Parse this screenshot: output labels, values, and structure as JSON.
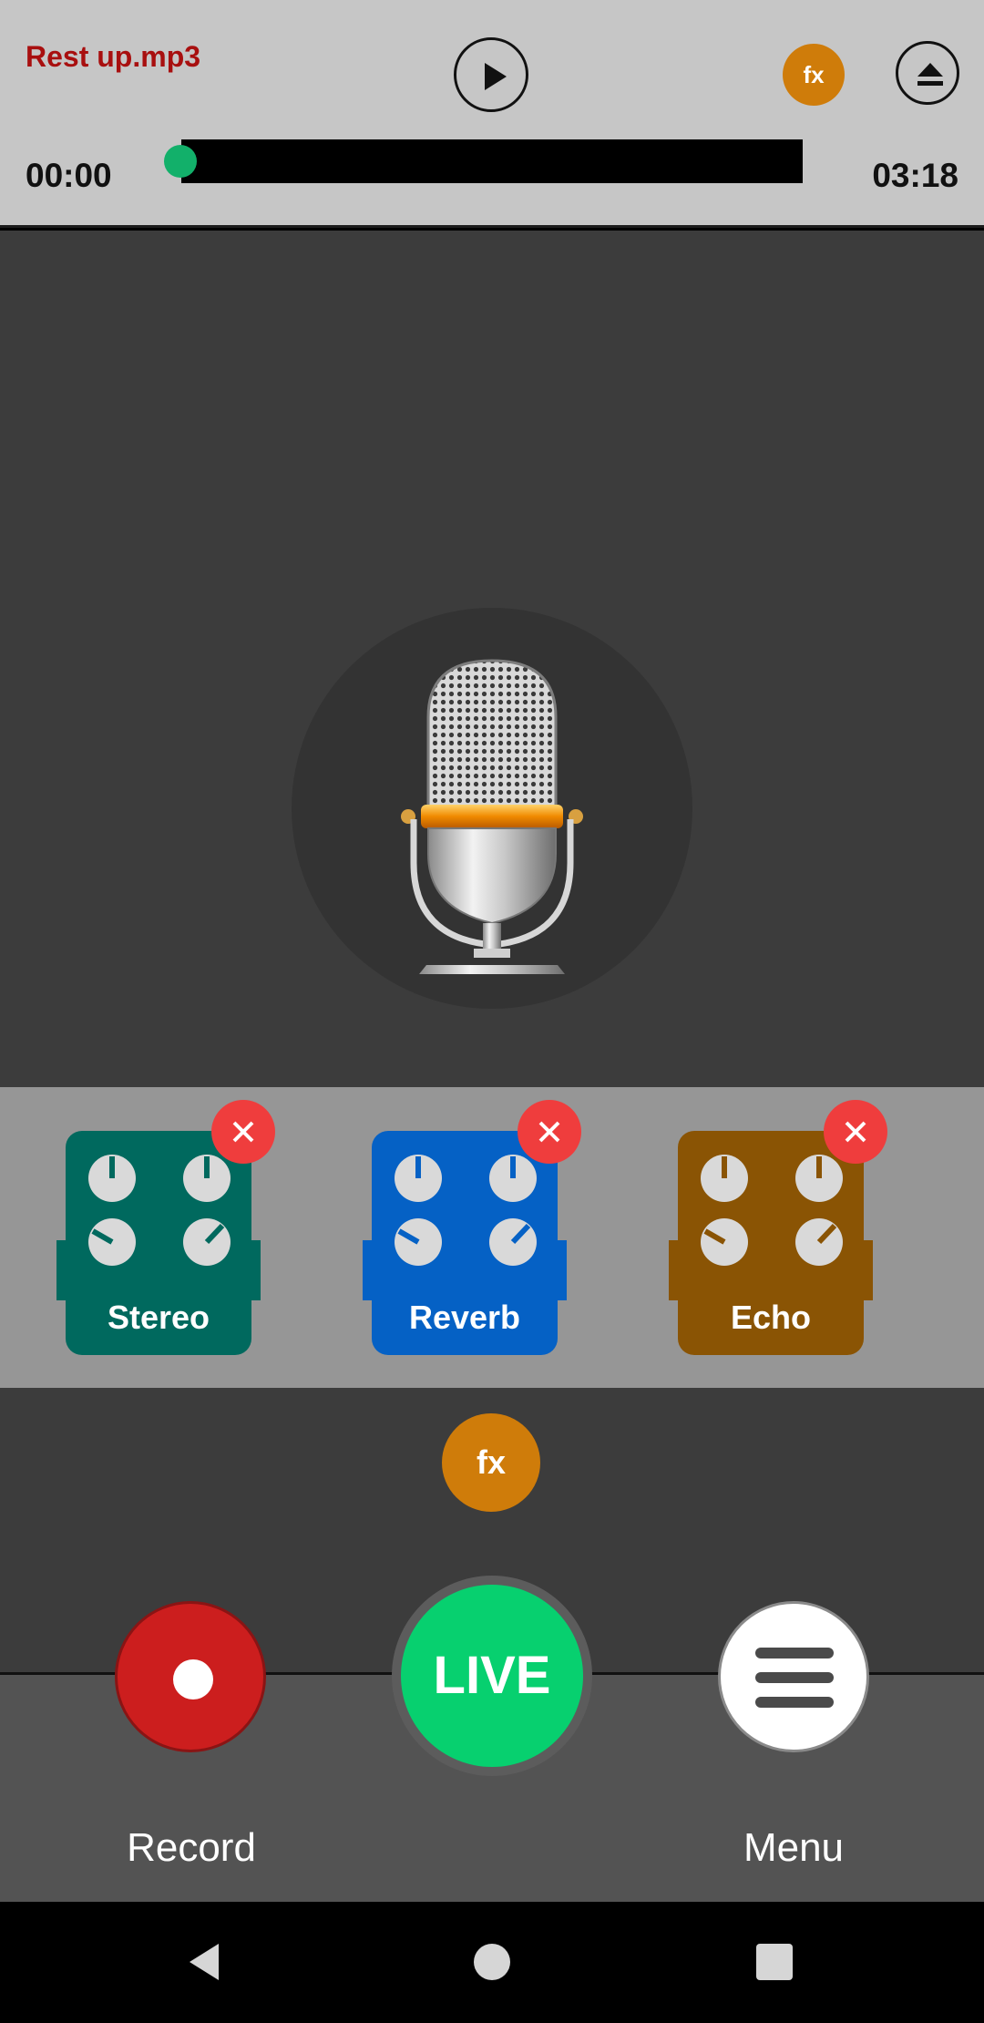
{
  "player": {
    "track_title": "Rest up.mp3",
    "current_time": "00:00",
    "duration": "03:18",
    "progress": 0.0,
    "play_icon": "play-icon",
    "fx_label": "fx",
    "eject_icon": "eject-icon"
  },
  "mic": {
    "icon": "microphone-icon"
  },
  "effects": [
    {
      "label": "Stereo",
      "color": "#00695e"
    },
    {
      "label": "Reverb",
      "color": "#0561c5"
    },
    {
      "label": "Echo",
      "color": "#8a5404"
    }
  ],
  "controls": {
    "fx_label": "fx",
    "record_label": "Record",
    "live_label": "LIVE",
    "menu_label": "Menu"
  },
  "colors": {
    "accent_orange": "#cf7c0a",
    "live_green": "#07d06f",
    "record_red": "#cc1e1e",
    "close_red": "#ef3d3d",
    "title_red": "#a80f0f"
  }
}
